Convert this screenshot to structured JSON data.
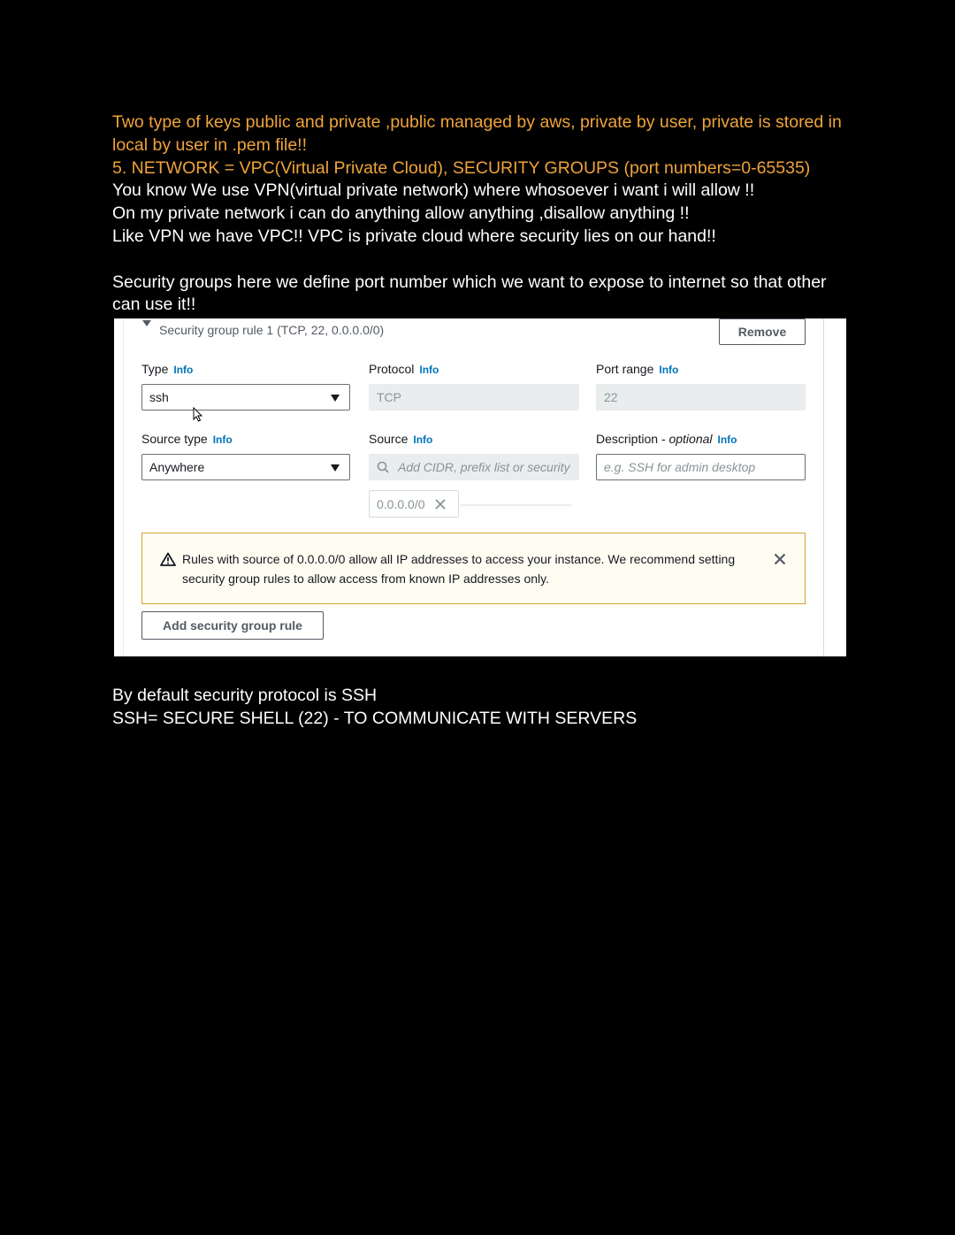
{
  "notes": {
    "line1": "Two type of keys public and private ,public managed by aws, private by user, private is stored in local by user in .pem file!!",
    "line2": "5. NETWORK = VPC(Virtual Private Cloud), SECURITY GROUPS (port numbers=0-65535)",
    "line3": "You know We use VPN(virtual private network) where whosoever i want i will allow !!",
    "line4": "On my private network i can do anything allow anything ,disallow anything !!",
    "line5": "Like VPN we have VPC!! VPC is private cloud where security lies on our hand!!",
    "line6": "Security groups here we define port number which we want to expose to internet so that other can use it!!",
    "line7": "By default security protocol is SSH",
    "line8": "SSH= SECURE SHELL (22) - TO COMMUNICATE WITH SERVERS"
  },
  "rule": {
    "header": "Security group rule 1 (TCP, 22, 0.0.0.0/0)",
    "remove_label": "Remove",
    "info": "Info",
    "type_label": "Type",
    "type_value": "ssh",
    "protocol_label": "Protocol",
    "protocol_value": "TCP",
    "port_label": "Port range",
    "port_value": "22",
    "source_type_label": "Source type",
    "source_type_value": "Anywhere",
    "source_label": "Source",
    "source_placeholder": "Add CIDR, prefix list or security",
    "source_token": "0.0.0.0/0",
    "desc_label": "Description - ",
    "desc_optional": "optional",
    "desc_placeholder": "e.g. SSH for admin desktop",
    "warning_text": "Rules with source of 0.0.0.0/0 allow all IP addresses to access your instance. We recommend setting security group rules to allow access from known IP addresses only.",
    "add_rule_label": "Add security group rule"
  },
  "colors": {
    "note_orange": "#f0a33a",
    "aws_link": "#0073bb",
    "warning_border": "#d4a434"
  }
}
